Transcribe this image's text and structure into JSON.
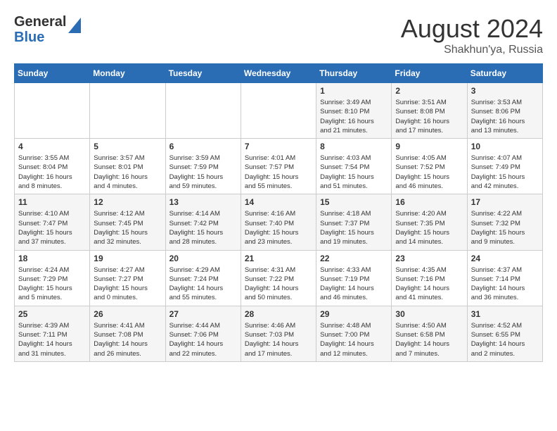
{
  "header": {
    "logo_line1": "General",
    "logo_line2": "Blue",
    "month_year": "August 2024",
    "location": "Shakhun'ya, Russia"
  },
  "weekdays": [
    "Sunday",
    "Monday",
    "Tuesday",
    "Wednesday",
    "Thursday",
    "Friday",
    "Saturday"
  ],
  "weeks": [
    [
      {
        "day": "",
        "info": ""
      },
      {
        "day": "",
        "info": ""
      },
      {
        "day": "",
        "info": ""
      },
      {
        "day": "",
        "info": ""
      },
      {
        "day": "1",
        "info": "Sunrise: 3:49 AM\nSunset: 8:10 PM\nDaylight: 16 hours\nand 21 minutes."
      },
      {
        "day": "2",
        "info": "Sunrise: 3:51 AM\nSunset: 8:08 PM\nDaylight: 16 hours\nand 17 minutes."
      },
      {
        "day": "3",
        "info": "Sunrise: 3:53 AM\nSunset: 8:06 PM\nDaylight: 16 hours\nand 13 minutes."
      }
    ],
    [
      {
        "day": "4",
        "info": "Sunrise: 3:55 AM\nSunset: 8:04 PM\nDaylight: 16 hours\nand 8 minutes."
      },
      {
        "day": "5",
        "info": "Sunrise: 3:57 AM\nSunset: 8:01 PM\nDaylight: 16 hours\nand 4 minutes."
      },
      {
        "day": "6",
        "info": "Sunrise: 3:59 AM\nSunset: 7:59 PM\nDaylight: 15 hours\nand 59 minutes."
      },
      {
        "day": "7",
        "info": "Sunrise: 4:01 AM\nSunset: 7:57 PM\nDaylight: 15 hours\nand 55 minutes."
      },
      {
        "day": "8",
        "info": "Sunrise: 4:03 AM\nSunset: 7:54 PM\nDaylight: 15 hours\nand 51 minutes."
      },
      {
        "day": "9",
        "info": "Sunrise: 4:05 AM\nSunset: 7:52 PM\nDaylight: 15 hours\nand 46 minutes."
      },
      {
        "day": "10",
        "info": "Sunrise: 4:07 AM\nSunset: 7:49 PM\nDaylight: 15 hours\nand 42 minutes."
      }
    ],
    [
      {
        "day": "11",
        "info": "Sunrise: 4:10 AM\nSunset: 7:47 PM\nDaylight: 15 hours\nand 37 minutes."
      },
      {
        "day": "12",
        "info": "Sunrise: 4:12 AM\nSunset: 7:45 PM\nDaylight: 15 hours\nand 32 minutes."
      },
      {
        "day": "13",
        "info": "Sunrise: 4:14 AM\nSunset: 7:42 PM\nDaylight: 15 hours\nand 28 minutes."
      },
      {
        "day": "14",
        "info": "Sunrise: 4:16 AM\nSunset: 7:40 PM\nDaylight: 15 hours\nand 23 minutes."
      },
      {
        "day": "15",
        "info": "Sunrise: 4:18 AM\nSunset: 7:37 PM\nDaylight: 15 hours\nand 19 minutes."
      },
      {
        "day": "16",
        "info": "Sunrise: 4:20 AM\nSunset: 7:35 PM\nDaylight: 15 hours\nand 14 minutes."
      },
      {
        "day": "17",
        "info": "Sunrise: 4:22 AM\nSunset: 7:32 PM\nDaylight: 15 hours\nand 9 minutes."
      }
    ],
    [
      {
        "day": "18",
        "info": "Sunrise: 4:24 AM\nSunset: 7:29 PM\nDaylight: 15 hours\nand 5 minutes."
      },
      {
        "day": "19",
        "info": "Sunrise: 4:27 AM\nSunset: 7:27 PM\nDaylight: 15 hours\nand 0 minutes."
      },
      {
        "day": "20",
        "info": "Sunrise: 4:29 AM\nSunset: 7:24 PM\nDaylight: 14 hours\nand 55 minutes."
      },
      {
        "day": "21",
        "info": "Sunrise: 4:31 AM\nSunset: 7:22 PM\nDaylight: 14 hours\nand 50 minutes."
      },
      {
        "day": "22",
        "info": "Sunrise: 4:33 AM\nSunset: 7:19 PM\nDaylight: 14 hours\nand 46 minutes."
      },
      {
        "day": "23",
        "info": "Sunrise: 4:35 AM\nSunset: 7:16 PM\nDaylight: 14 hours\nand 41 minutes."
      },
      {
        "day": "24",
        "info": "Sunrise: 4:37 AM\nSunset: 7:14 PM\nDaylight: 14 hours\nand 36 minutes."
      }
    ],
    [
      {
        "day": "25",
        "info": "Sunrise: 4:39 AM\nSunset: 7:11 PM\nDaylight: 14 hours\nand 31 minutes."
      },
      {
        "day": "26",
        "info": "Sunrise: 4:41 AM\nSunset: 7:08 PM\nDaylight: 14 hours\nand 26 minutes."
      },
      {
        "day": "27",
        "info": "Sunrise: 4:44 AM\nSunset: 7:06 PM\nDaylight: 14 hours\nand 22 minutes."
      },
      {
        "day": "28",
        "info": "Sunrise: 4:46 AM\nSunset: 7:03 PM\nDaylight: 14 hours\nand 17 minutes."
      },
      {
        "day": "29",
        "info": "Sunrise: 4:48 AM\nSunset: 7:00 PM\nDaylight: 14 hours\nand 12 minutes."
      },
      {
        "day": "30",
        "info": "Sunrise: 4:50 AM\nSunset: 6:58 PM\nDaylight: 14 hours\nand 7 minutes."
      },
      {
        "day": "31",
        "info": "Sunrise: 4:52 AM\nSunset: 6:55 PM\nDaylight: 14 hours\nand 2 minutes."
      }
    ]
  ]
}
